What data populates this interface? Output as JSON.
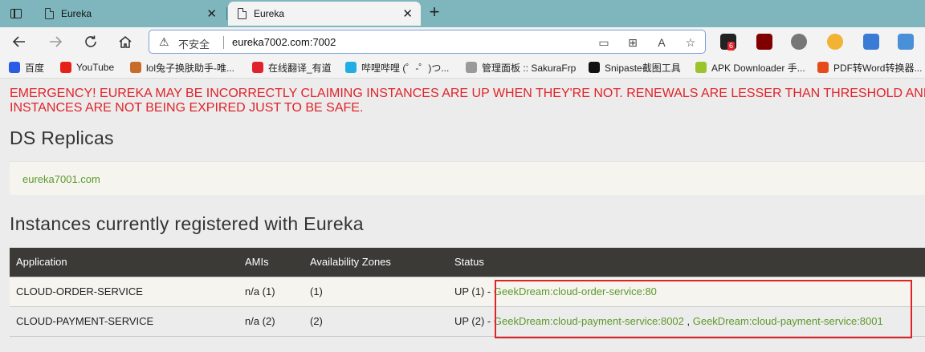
{
  "browser": {
    "tabs": [
      {
        "title": "Eureka",
        "active": false
      },
      {
        "title": "Eureka",
        "active": true
      }
    ],
    "address": {
      "security_label": "不安全",
      "url": "eureka7002.com:7002"
    },
    "extension_badge": "6",
    "bookmarks": [
      {
        "label": "百度",
        "icon": "paw-icon",
        "color": "#2b5ce6"
      },
      {
        "label": "YouTube",
        "icon": "youtube-icon",
        "color": "#e62117"
      },
      {
        "label": "lol兔子换肤助手-唯...",
        "icon": "rabbit-icon",
        "color": "#c96b2a"
      },
      {
        "label": "在线翻译_有道",
        "icon": "youdao-icon",
        "color": "#e0232a"
      },
      {
        "label": "哔哩哔哩 (゜-゜)つ...",
        "icon": "bilibili-icon",
        "color": "#23ade5"
      },
      {
        "label": "管理面板 :: SakuraFrp",
        "icon": "sakura-icon",
        "color": "#9a9a9a"
      },
      {
        "label": "Snipaste截图工具",
        "icon": "snipaste-icon",
        "color": "#111111"
      },
      {
        "label": "APK Downloader 手...",
        "icon": "apk-icon",
        "color": "#9bc32a"
      },
      {
        "label": "PDF转Word转换器...",
        "icon": "pdf-icon",
        "color": "#e64a19"
      }
    ]
  },
  "page": {
    "emergency_line1": "EMERGENCY! EUREKA MAY BE INCORRECTLY CLAIMING INSTANCES ARE UP WHEN THEY'RE NOT. RENEWALS ARE LESSER THAN THRESHOLD AND HENCE THE",
    "emergency_line2": "INSTANCES ARE NOT BEING EXPIRED JUST TO BE SAFE.",
    "ds_replicas_title": "DS Replicas",
    "replica_link": "eureka7001.com",
    "instances_title": "Instances currently registered with Eureka",
    "table": {
      "headers": [
        "Application",
        "AMIs",
        "Availability Zones",
        "Status"
      ],
      "rows": [
        {
          "application": "CLOUD-ORDER-SERVICE",
          "amis": "n/a (1)",
          "zones": "(1)",
          "status_prefix": "UP (1) - ",
          "instances": [
            "GeekDream:cloud-order-service:80"
          ]
        },
        {
          "application": "CLOUD-PAYMENT-SERVICE",
          "amis": "n/a (2)",
          "zones": "(2)",
          "status_prefix": "UP (2) - ",
          "instances": [
            "GeekDream:cloud-payment-service:8002",
            "GeekDream:cloud-payment-service:8001"
          ],
          "instance_separator": " , "
        }
      ]
    },
    "colors": {
      "emergency": "#e0232a",
      "link": "#5b9a2a",
      "table_header": "#3c3a37",
      "highlight_box": "#e0232a"
    }
  }
}
